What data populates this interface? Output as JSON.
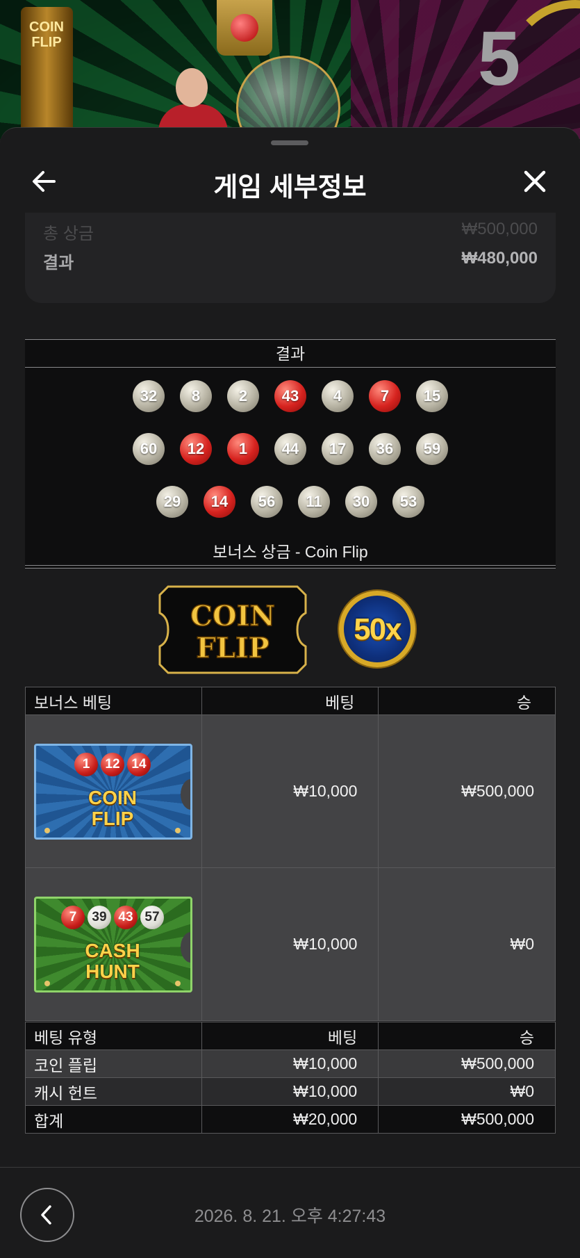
{
  "scene": {
    "pillar_text": "COIN FLIP",
    "round_number": "5"
  },
  "header": {
    "title": "게임 세부정보"
  },
  "summary": {
    "total_prize_label": "총 상금",
    "total_prize_value": "₩500,000",
    "result_label": "결과",
    "result_value": "₩480,000"
  },
  "results": {
    "header": "결과",
    "rows": [
      [
        {
          "n": "32",
          "c": "white"
        },
        {
          "n": "8",
          "c": "white"
        },
        {
          "n": "2",
          "c": "white"
        },
        {
          "n": "43",
          "c": "red"
        },
        {
          "n": "4",
          "c": "white"
        },
        {
          "n": "7",
          "c": "red"
        },
        {
          "n": "15",
          "c": "white"
        }
      ],
      [
        {
          "n": "60",
          "c": "white"
        },
        {
          "n": "12",
          "c": "red"
        },
        {
          "n": "1",
          "c": "red"
        },
        {
          "n": "44",
          "c": "white"
        },
        {
          "n": "17",
          "c": "white"
        },
        {
          "n": "36",
          "c": "white"
        },
        {
          "n": "59",
          "c": "white"
        }
      ],
      [
        {
          "n": "29",
          "c": "white"
        },
        {
          "n": "14",
          "c": "red"
        },
        {
          "n": "56",
          "c": "white"
        },
        {
          "n": "11",
          "c": "white"
        },
        {
          "n": "30",
          "c": "white"
        },
        {
          "n": "53",
          "c": "white"
        }
      ]
    ]
  },
  "bonus": {
    "title": "보너스 상금 - Coin Flip",
    "logo_text_1": "COIN",
    "logo_text_2": "FLIP",
    "multiplier": "50x"
  },
  "bonus_bets": {
    "headers": [
      "보너스 베팅",
      "베팅",
      "승"
    ],
    "rows": [
      {
        "ticket": "coin-flip",
        "ticket_name_1": "COIN",
        "ticket_name_2": "FLIP",
        "ticket_numbers": [
          "1",
          "12",
          "14"
        ],
        "bet": "₩10,000",
        "win": "₩500,000"
      },
      {
        "ticket": "cash-hunt",
        "ticket_name_1": "CASH",
        "ticket_name_2": "HUNT",
        "ticket_numbers": [
          "7",
          "39",
          "43",
          "57"
        ],
        "bet": "₩10,000",
        "win": "₩0"
      }
    ]
  },
  "bet_types": {
    "headers": [
      "베팅 유형",
      "베팅",
      "승"
    ],
    "rows": [
      {
        "type": "코인 플립",
        "bet": "₩10,000",
        "win": "₩500,000"
      },
      {
        "type": "캐시 헌트",
        "bet": "₩10,000",
        "win": "₩0"
      }
    ],
    "total": {
      "type": "합계",
      "bet": "₩20,000",
      "win": "₩500,000"
    }
  },
  "footer": {
    "timestamp": "2026. 8. 21. 오후 4:27:43"
  },
  "colors": {
    "red_ball": "#d6231f",
    "white_ball": "#b7b3a3",
    "sheet_bg": "#1b1b1c"
  }
}
